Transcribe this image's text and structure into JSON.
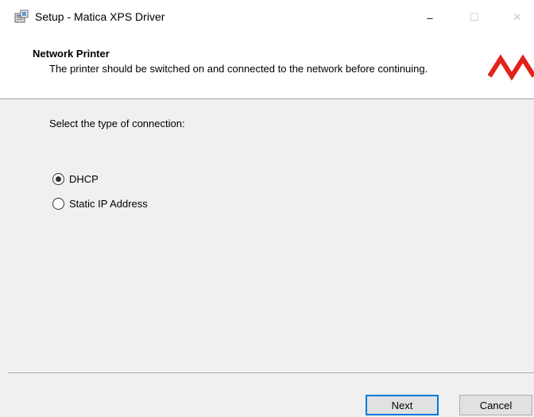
{
  "window": {
    "title": "Setup - Matica XPS Driver",
    "app_icon": "installer-icon",
    "controls": {
      "minimize": "–",
      "maximize": "☐",
      "close": "✕"
    }
  },
  "header": {
    "title": "Network Printer",
    "subtitle": "The printer should be switched on and connected to the network before continuing.",
    "logo_icon": "matica-logo-icon",
    "logo_color": "#e2231a"
  },
  "content": {
    "prompt": "Select the type of connection:",
    "options": [
      {
        "label": "DHCP",
        "checked": true
      },
      {
        "label": "Static IP Address",
        "checked": false
      }
    ]
  },
  "footer": {
    "next_label": "Next",
    "cancel_label": "Cancel"
  },
  "colors": {
    "accent": "#0078d7",
    "background": "#f0f0f0",
    "header_background": "#ffffff"
  }
}
